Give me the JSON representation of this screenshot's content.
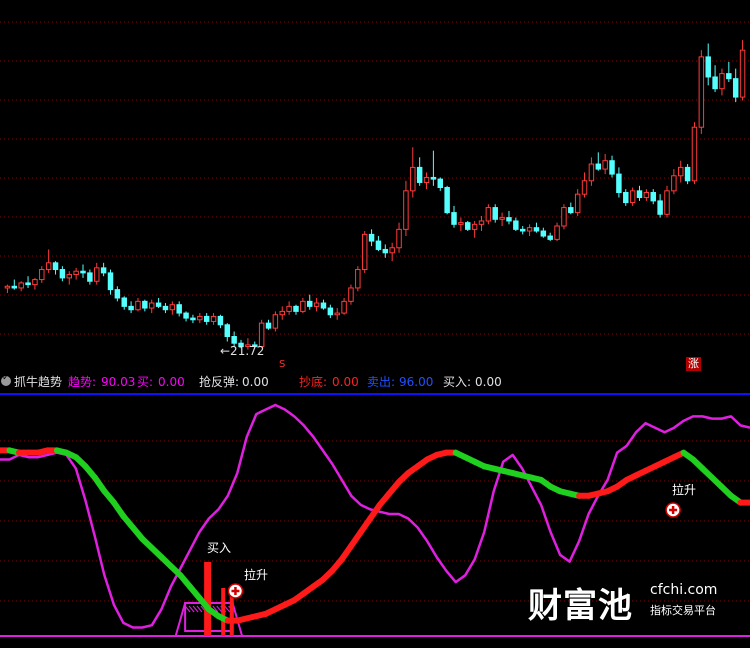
{
  "colors": {
    "up": "#ff3b3b",
    "down": "#54ffff",
    "grid": "#8b0000",
    "panel_divider": "#1010ff",
    "trend_up": "#ff1a1a",
    "trend_down": "#1fd01f",
    "curve": "#e020e0",
    "bottom_line": "#e020e0"
  },
  "price_panel": {
    "low_marker": "←21.72",
    "s_marker": "S",
    "zhang_marker": "涨"
  },
  "indicator_bar": {
    "name": "抓牛趋势",
    "items": [
      {
        "label": "趋势:",
        "value": "90.03",
        "color": "#ff00ff"
      },
      {
        "label": "买:",
        "value": "0.00",
        "color": "#ff00ff"
      },
      {
        "label": "抢反弹:",
        "value": "0.00",
        "color": "#e0e0e0"
      },
      {
        "label": "抄底:",
        "value": "0.00",
        "color": "#ff2020"
      },
      {
        "label": "卖出:",
        "value": "96.00",
        "color": "#2050ff"
      },
      {
        "label": "买入:",
        "value": "0.00",
        "color": "#e0e0e0"
      }
    ]
  },
  "annotations": {
    "buy": "买入",
    "rise_1": "拉升",
    "rise_2": "拉升"
  },
  "watermark": {
    "brand": "财富池",
    "domain": "cfchi.com",
    "slogan": "指标交易平台"
  },
  "chart_data": [
    {
      "type": "candlestick",
      "title": "",
      "low_label_value": 21.72,
      "candles": [
        [
          25.4,
          25.6,
          25.1,
          25.5
        ],
        [
          25.5,
          25.9,
          25.3,
          25.4
        ],
        [
          25.4,
          25.8,
          25.2,
          25.7
        ],
        [
          25.7,
          26.1,
          25.4,
          25.6
        ],
        [
          25.6,
          26.0,
          25.3,
          25.9
        ],
        [
          25.9,
          26.7,
          25.7,
          26.5
        ],
        [
          26.5,
          27.7,
          26.3,
          26.9
        ],
        [
          26.9,
          27.0,
          26.2,
          26.5
        ],
        [
          26.5,
          26.7,
          25.8,
          26.0
        ],
        [
          26.0,
          26.4,
          25.6,
          26.2
        ],
        [
          26.2,
          26.6,
          25.9,
          26.4
        ],
        [
          26.4,
          26.8,
          26.0,
          26.3
        ],
        [
          26.3,
          26.5,
          25.6,
          25.8
        ],
        [
          25.8,
          26.9,
          25.6,
          26.6
        ],
        [
          26.6,
          26.9,
          26.1,
          26.3
        ],
        [
          26.3,
          26.5,
          25.0,
          25.3
        ],
        [
          25.3,
          25.5,
          24.6,
          24.8
        ],
        [
          24.8,
          24.9,
          24.1,
          24.3
        ],
        [
          24.3,
          24.6,
          23.9,
          24.1
        ],
        [
          24.1,
          24.8,
          24.0,
          24.6
        ],
        [
          24.6,
          24.7,
          24.0,
          24.2
        ],
        [
          24.2,
          24.7,
          23.9,
          24.5
        ],
        [
          24.5,
          24.8,
          24.2,
          24.3
        ],
        [
          24.3,
          24.5,
          23.9,
          24.1
        ],
        [
          24.1,
          24.6,
          23.8,
          24.4
        ],
        [
          24.4,
          24.6,
          23.7,
          23.9
        ],
        [
          23.9,
          24.0,
          23.4,
          23.6
        ],
        [
          23.6,
          23.8,
          23.3,
          23.5
        ],
        [
          23.5,
          23.9,
          23.3,
          23.7
        ],
        [
          23.7,
          23.9,
          23.2,
          23.4
        ],
        [
          23.4,
          23.9,
          23.2,
          23.7
        ],
        [
          23.7,
          23.8,
          23.0,
          23.2
        ],
        [
          23.2,
          23.3,
          22.2,
          22.5
        ],
        [
          22.5,
          22.8,
          21.9,
          22.1
        ],
        [
          22.1,
          22.3,
          21.8,
          21.9
        ],
        [
          21.9,
          22.4,
          21.72,
          22.0
        ],
        [
          22.0,
          22.2,
          21.8,
          21.9
        ],
        [
          21.9,
          23.5,
          21.9,
          23.3
        ],
        [
          23.3,
          23.5,
          22.9,
          23.0
        ],
        [
          23.0,
          24.0,
          22.8,
          23.8
        ],
        [
          23.8,
          24.3,
          23.5,
          24.0
        ],
        [
          24.0,
          24.6,
          23.8,
          24.3
        ],
        [
          24.3,
          24.4,
          23.8,
          24.0
        ],
        [
          24.0,
          24.8,
          23.9,
          24.6
        ],
        [
          24.6,
          25.0,
          24.1,
          24.3
        ],
        [
          24.3,
          24.8,
          24.0,
          24.5
        ],
        [
          24.5,
          24.7,
          24.1,
          24.2
        ],
        [
          24.2,
          24.4,
          23.6,
          23.8
        ],
        [
          23.8,
          24.2,
          23.5,
          23.9
        ],
        [
          23.9,
          24.8,
          23.8,
          24.6
        ],
        [
          24.6,
          25.6,
          24.4,
          25.4
        ],
        [
          25.4,
          26.7,
          25.2,
          26.5
        ],
        [
          26.5,
          28.8,
          26.3,
          28.6
        ],
        [
          28.6,
          28.9,
          27.9,
          28.2
        ],
        [
          28.2,
          28.5,
          27.6,
          27.7
        ],
        [
          27.7,
          28.0,
          27.2,
          27.5
        ],
        [
          27.5,
          28.1,
          27.0,
          27.8
        ],
        [
          27.8,
          29.3,
          27.5,
          28.9
        ],
        [
          28.9,
          31.8,
          28.5,
          31.2
        ],
        [
          31.2,
          33.8,
          30.8,
          32.6
        ],
        [
          32.6,
          33.2,
          31.5,
          31.7
        ],
        [
          31.7,
          32.3,
          31.3,
          32.0
        ],
        [
          32.0,
          33.6,
          31.5,
          31.9
        ],
        [
          31.9,
          32.0,
          31.2,
          31.4
        ],
        [
          31.4,
          31.5,
          29.8,
          29.9
        ],
        [
          29.9,
          30.3,
          29.0,
          29.2
        ],
        [
          29.2,
          29.6,
          28.8,
          29.3
        ],
        [
          29.3,
          29.4,
          28.8,
          28.9
        ],
        [
          28.9,
          29.4,
          28.4,
          29.2
        ],
        [
          29.2,
          29.7,
          28.8,
          29.4
        ],
        [
          29.4,
          30.4,
          29.2,
          30.2
        ],
        [
          30.2,
          30.4,
          29.3,
          29.5
        ],
        [
          29.5,
          29.9,
          29.1,
          29.6
        ],
        [
          29.6,
          30.0,
          29.2,
          29.4
        ],
        [
          29.4,
          29.6,
          28.8,
          28.9
        ],
        [
          28.9,
          29.1,
          28.6,
          28.8
        ],
        [
          28.8,
          29.2,
          28.5,
          29.0
        ],
        [
          29.0,
          29.3,
          28.7,
          28.8
        ],
        [
          28.8,
          29.0,
          28.4,
          28.5
        ],
        [
          28.5,
          28.7,
          28.2,
          28.3
        ],
        [
          28.3,
          29.3,
          28.2,
          29.1
        ],
        [
          29.1,
          30.4,
          28.9,
          30.2
        ],
        [
          30.2,
          30.5,
          29.8,
          29.9
        ],
        [
          29.9,
          31.3,
          29.7,
          31.0
        ],
        [
          31.0,
          32.3,
          30.8,
          31.8
        ],
        [
          31.8,
          33.2,
          31.5,
          32.8
        ],
        [
          32.8,
          33.5,
          32.4,
          32.5
        ],
        [
          32.5,
          33.4,
          32.2,
          33.0
        ],
        [
          33.0,
          33.3,
          32.0,
          32.2
        ],
        [
          32.2,
          32.6,
          30.8,
          31.1
        ],
        [
          31.1,
          31.3,
          30.3,
          30.5
        ],
        [
          30.5,
          31.4,
          30.3,
          31.2
        ],
        [
          31.2,
          31.5,
          30.6,
          30.8
        ],
        [
          30.8,
          31.3,
          30.6,
          31.1
        ],
        [
          31.1,
          31.3,
          30.4,
          30.6
        ],
        [
          30.6,
          31.0,
          29.6,
          29.8
        ],
        [
          29.8,
          31.5,
          29.6,
          31.2
        ],
        [
          31.2,
          32.5,
          31.0,
          32.1
        ],
        [
          32.1,
          33.0,
          31.7,
          32.6
        ],
        [
          32.6,
          32.8,
          31.6,
          31.8
        ],
        [
          31.8,
          35.3,
          31.6,
          35.0
        ],
        [
          35.0,
          39.6,
          34.6,
          39.2
        ],
        [
          39.2,
          40.0,
          37.5,
          38.0
        ],
        [
          38.0,
          38.7,
          37.1,
          37.3
        ],
        [
          37.3,
          38.5,
          36.9,
          38.2
        ],
        [
          38.2,
          38.9,
          37.7,
          37.9
        ],
        [
          37.9,
          38.5,
          36.5,
          36.8
        ],
        [
          36.8,
          40.2,
          36.6,
          39.6
        ]
      ],
      "ylim": [
        20.5,
        42.0
      ]
    },
    {
      "type": "line",
      "title": "抓牛趋势",
      "series": [
        {
          "name": "趋势",
          "colors_by_direction": {
            "up": "#ff1a1a",
            "down": "#1fd01f"
          },
          "values": [
            80,
            80,
            79,
            79,
            79,
            80,
            80,
            79,
            77,
            73,
            68,
            62,
            57,
            51,
            46,
            41,
            37,
            33,
            29,
            25,
            20,
            15,
            10,
            7,
            5,
            5,
            6,
            7,
            8,
            10,
            12,
            14,
            17,
            20,
            23,
            27,
            32,
            38,
            44,
            50,
            56,
            61,
            66,
            70,
            73,
            76,
            78,
            79,
            79,
            77,
            75,
            73,
            72,
            71,
            70,
            69,
            68,
            67,
            64,
            62,
            61,
            60,
            60,
            61,
            62,
            64,
            67,
            69,
            71,
            73,
            75,
            77,
            79,
            76,
            72,
            68,
            64,
            60,
            57,
            57
          ]
        },
        {
          "name": "",
          "values": [
            76,
            76,
            78,
            77,
            77,
            78,
            79,
            78,
            72,
            58,
            42,
            25,
            12,
            4,
            2,
            2,
            3,
            10,
            20,
            28,
            36,
            44,
            50,
            54,
            60,
            70,
            86,
            96,
            98,
            100,
            98,
            95,
            91,
            86,
            80,
            74,
            67,
            60,
            56,
            54,
            53,
            52,
            52,
            50,
            46,
            40,
            33,
            27,
            22,
            25,
            32,
            44,
            62,
            75,
            78,
            72,
            64,
            56,
            44,
            34,
            31,
            40,
            52,
            60,
            67,
            79,
            82,
            88,
            92,
            90,
            88,
            90,
            93,
            95,
            95,
            94,
            94,
            95,
            91,
            90
          ]
        }
      ],
      "ylim": [
        0,
        100
      ],
      "signals": [
        {
          "type": "buy",
          "label": "买入"
        },
        {
          "type": "rise",
          "label": "拉升"
        },
        {
          "type": "rise",
          "label": "拉升"
        }
      ]
    }
  ]
}
